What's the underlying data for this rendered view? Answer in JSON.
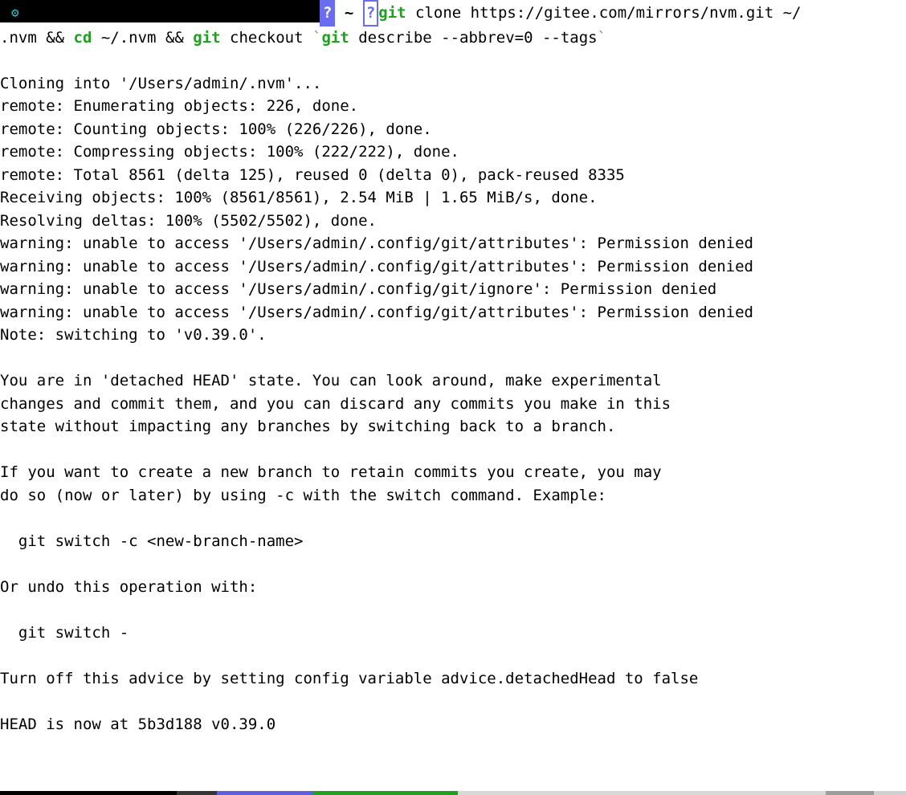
{
  "prompt": {
    "box1": "?",
    "tilde": "~",
    "box2": "?"
  },
  "command": {
    "git1": "git",
    "clone_rest": " clone https://gitee.com/mirrors/nvm.git ~/",
    "line2a": ".nvm ",
    "amp1": "&&",
    "cd": " cd",
    "cdarg": " ~/.nvm ",
    "amp2": "&&",
    "git2": " git",
    "checkout": " checkout ",
    "backtick1": "`",
    "git3": "git",
    "describe": " describe --abbrev=0 --tags",
    "backtick2": "`"
  },
  "output": {
    "l1": "Cloning into '/Users/admin/.nvm'...",
    "l2": "remote: Enumerating objects: 226, done.",
    "l3": "remote: Counting objects: 100% (226/226), done.",
    "l4": "remote: Compressing objects: 100% (222/222), done.",
    "l5": "remote: Total 8561 (delta 125), reused 0 (delta 0), pack-reused 8335",
    "l6": "Receiving objects: 100% (8561/8561), 2.54 MiB | 1.65 MiB/s, done.",
    "l7": "Resolving deltas: 100% (5502/5502), done.",
    "l8": "warning: unable to access '/Users/admin/.config/git/attributes': Permission denied",
    "l9": "warning: unable to access '/Users/admin/.config/git/attributes': Permission denied",
    "l10": "warning: unable to access '/Users/admin/.config/git/ignore': Permission denied",
    "l11": "warning: unable to access '/Users/admin/.config/git/attributes': Permission denied",
    "l12": "Note: switching to 'v0.39.0'.",
    "l13": "You are in 'detached HEAD' state. You can look around, make experimental",
    "l14": "changes and commit them, and you can discard any commits you make in this",
    "l15": "state without impacting any branches by switching back to a branch.",
    "l16": "If you want to create a new branch to retain commits you create, you may",
    "l17": "do so (now or later) by using -c with the switch command. Example:",
    "l18": "  git switch -c <new-branch-name>",
    "l19": "Or undo this operation with:",
    "l20": "  git switch -",
    "l21": "Turn off this advice by setting config variable advice.detachedHead to false",
    "l22": "HEAD is now at 5b3d188 v0.39.0"
  }
}
